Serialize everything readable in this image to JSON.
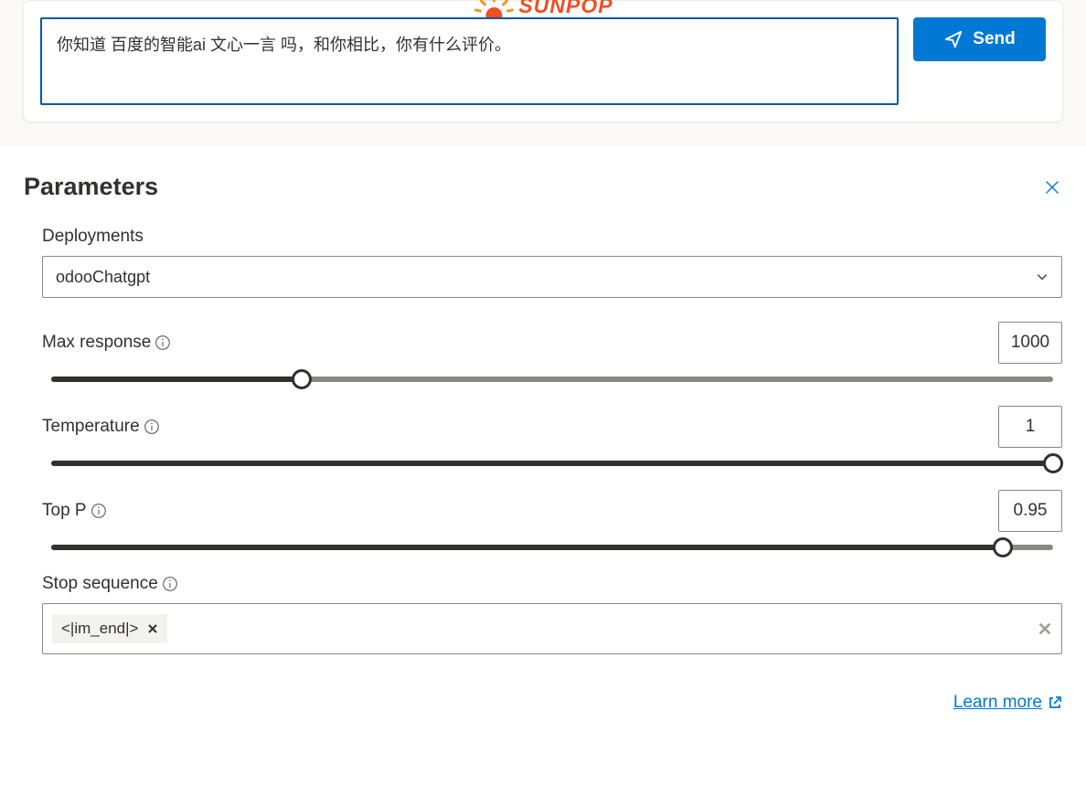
{
  "watermark": {
    "text": "SUNPOP"
  },
  "input": {
    "value": "你知道 百度的智能ai 文心一言 吗，和你相比，你有什么评价。",
    "send_label": "Send"
  },
  "parameters": {
    "title": "Parameters",
    "deployments": {
      "label": "Deployments",
      "selected": "odooChatgpt"
    },
    "max_response": {
      "label": "Max response",
      "value": "1000",
      "fill_pct": 25
    },
    "temperature": {
      "label": "Temperature",
      "value": "1",
      "fill_pct": 100
    },
    "top_p": {
      "label": "Top P",
      "value": "0.95",
      "fill_pct": 95
    },
    "stop_sequence": {
      "label": "Stop sequence",
      "tags": [
        "<|im_end|>"
      ]
    }
  },
  "learn_more": {
    "label": "Learn more"
  }
}
